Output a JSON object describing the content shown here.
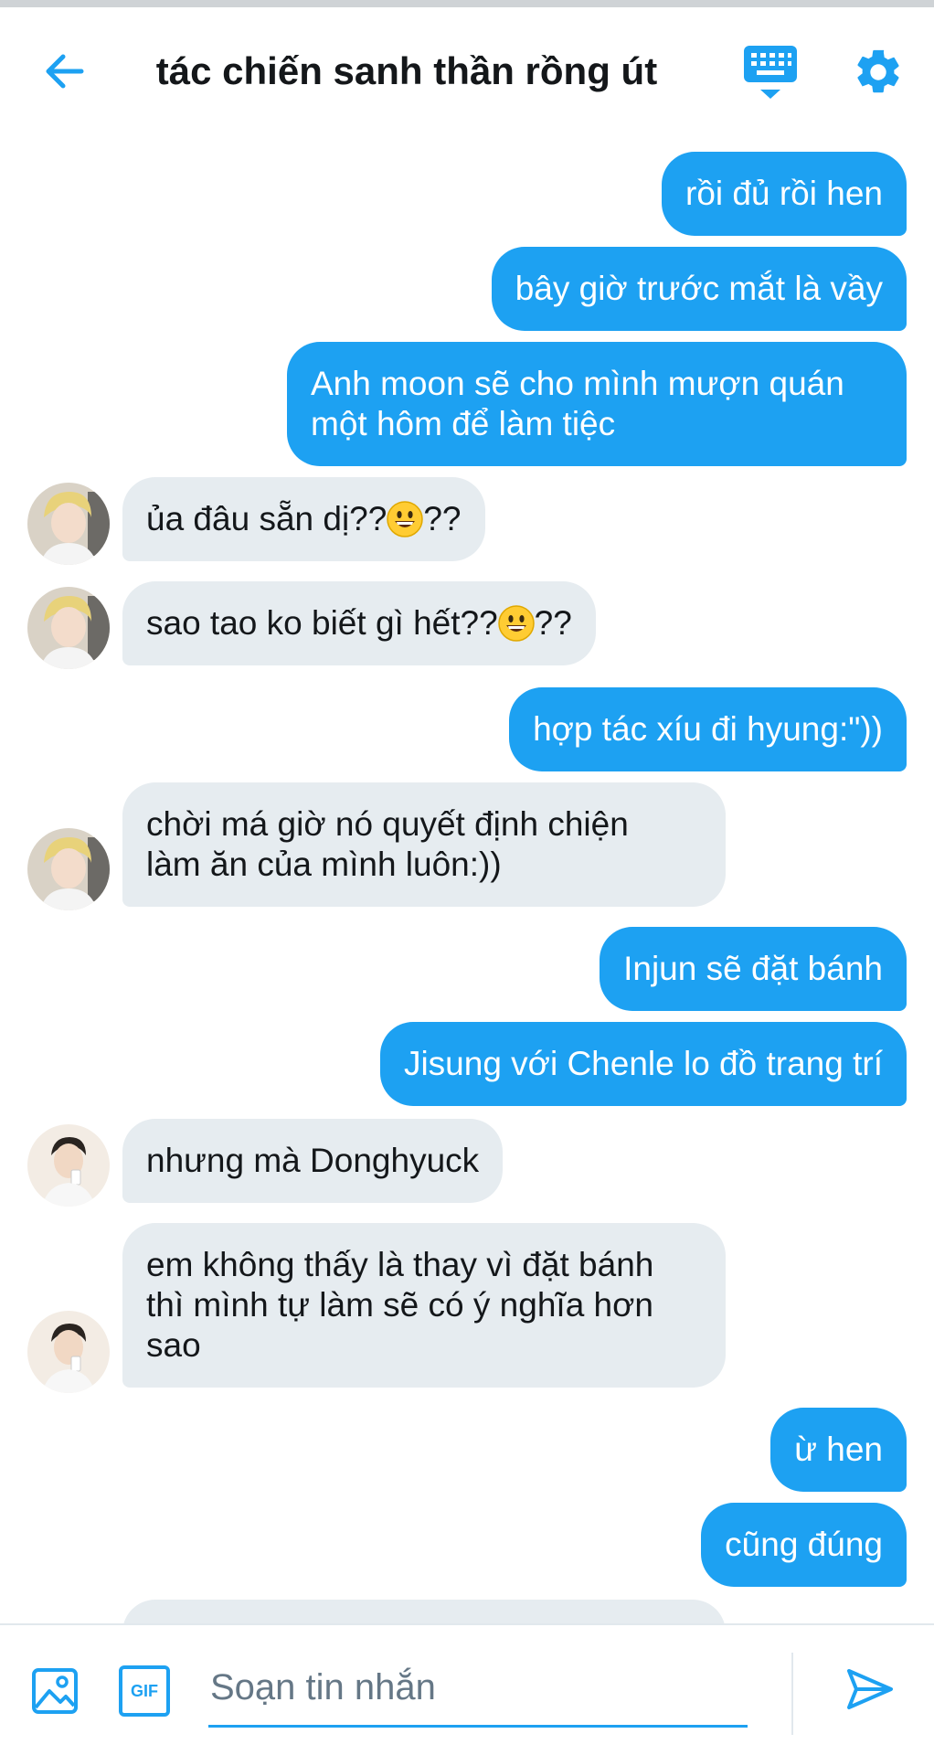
{
  "header": {
    "title": "tác chiến sanh thần rồng út"
  },
  "messages": [
    {
      "side": "sent",
      "text": "rồi đủ rồi hen"
    },
    {
      "side": "sent",
      "text": "bây giờ trước mắt là vầy"
    },
    {
      "side": "sent",
      "lines": [
        "Anh moon sẽ cho mình mượn quán",
        "một hôm để làm tiệc"
      ]
    },
    {
      "side": "recv",
      "pre": "ủa đâu sẵn dị??",
      "post": "??"
    },
    {
      "side": "recv",
      "pre": "sao tao ko biết gì hết??",
      "post": "??"
    },
    {
      "side": "sent",
      "text": "hợp tác xíu đi hyung:\"))"
    },
    {
      "side": "recv",
      "lines": [
        "chời má giờ nó quyết định chiện",
        "làm ăn của mình luôn:))"
      ]
    },
    {
      "side": "sent",
      "text": "Injun sẽ đặt bánh"
    },
    {
      "side": "sent",
      "text": "Jisung với Chenle lo đồ trang trí"
    },
    {
      "side": "recv",
      "text": "nhưng mà Donghyuck"
    },
    {
      "side": "recv",
      "lines": [
        "em không thấy là thay vì đặt bánh",
        "thì mình tự làm sẽ có ý nghĩa hơn",
        "sao"
      ]
    },
    {
      "side": "sent",
      "text": "ừ hen"
    },
    {
      "side": "sent",
      "text": "cũng đúng"
    }
  ],
  "composer": {
    "placeholder": "Soạn tin nhắn",
    "gif_label": "GIF"
  },
  "colors": {
    "accent": "#1da1f2",
    "received_bubble": "#e6ecf0"
  },
  "icons": {
    "back": "arrow-left-icon",
    "keyboard": "keyboard-icon",
    "settings": "gear-icon",
    "image": "image-icon",
    "send": "send-icon"
  }
}
